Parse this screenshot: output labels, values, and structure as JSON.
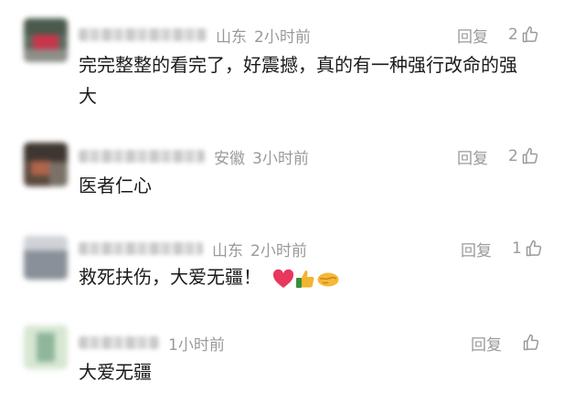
{
  "comments": [
    {
      "location": "山东",
      "time": "2小时前",
      "reply_label": "回复",
      "likes": "2",
      "text": "完完整整的看完了，好震撼，真的有一种强行改命的强大",
      "text_lines": [
        "完完整整的看完了，好震撼，真的有一种强行改命的强",
        "大"
      ]
    },
    {
      "location": "安徽",
      "time": "3小时前",
      "reply_label": "回复",
      "likes": "2",
      "text": "医者仁心"
    },
    {
      "location": "山东",
      "time": "2小时前",
      "reply_label": "回复",
      "likes": "1",
      "text": "救死扶伤，大爱无疆！",
      "emojis": [
        "red-heart",
        "thumbs-up",
        "handshake"
      ]
    },
    {
      "location": "",
      "time": "1小时前",
      "reply_label": "回复",
      "likes": "",
      "text": "大爱无疆"
    }
  ],
  "colors": {
    "meta_gray": "#9a9a9a",
    "text": "#1a1a1a",
    "heart": "#e8365d",
    "thumb": "#f2b531",
    "handshake": "#f5b83a"
  },
  "icons": {
    "like": "thumbs-up-outline-icon"
  }
}
